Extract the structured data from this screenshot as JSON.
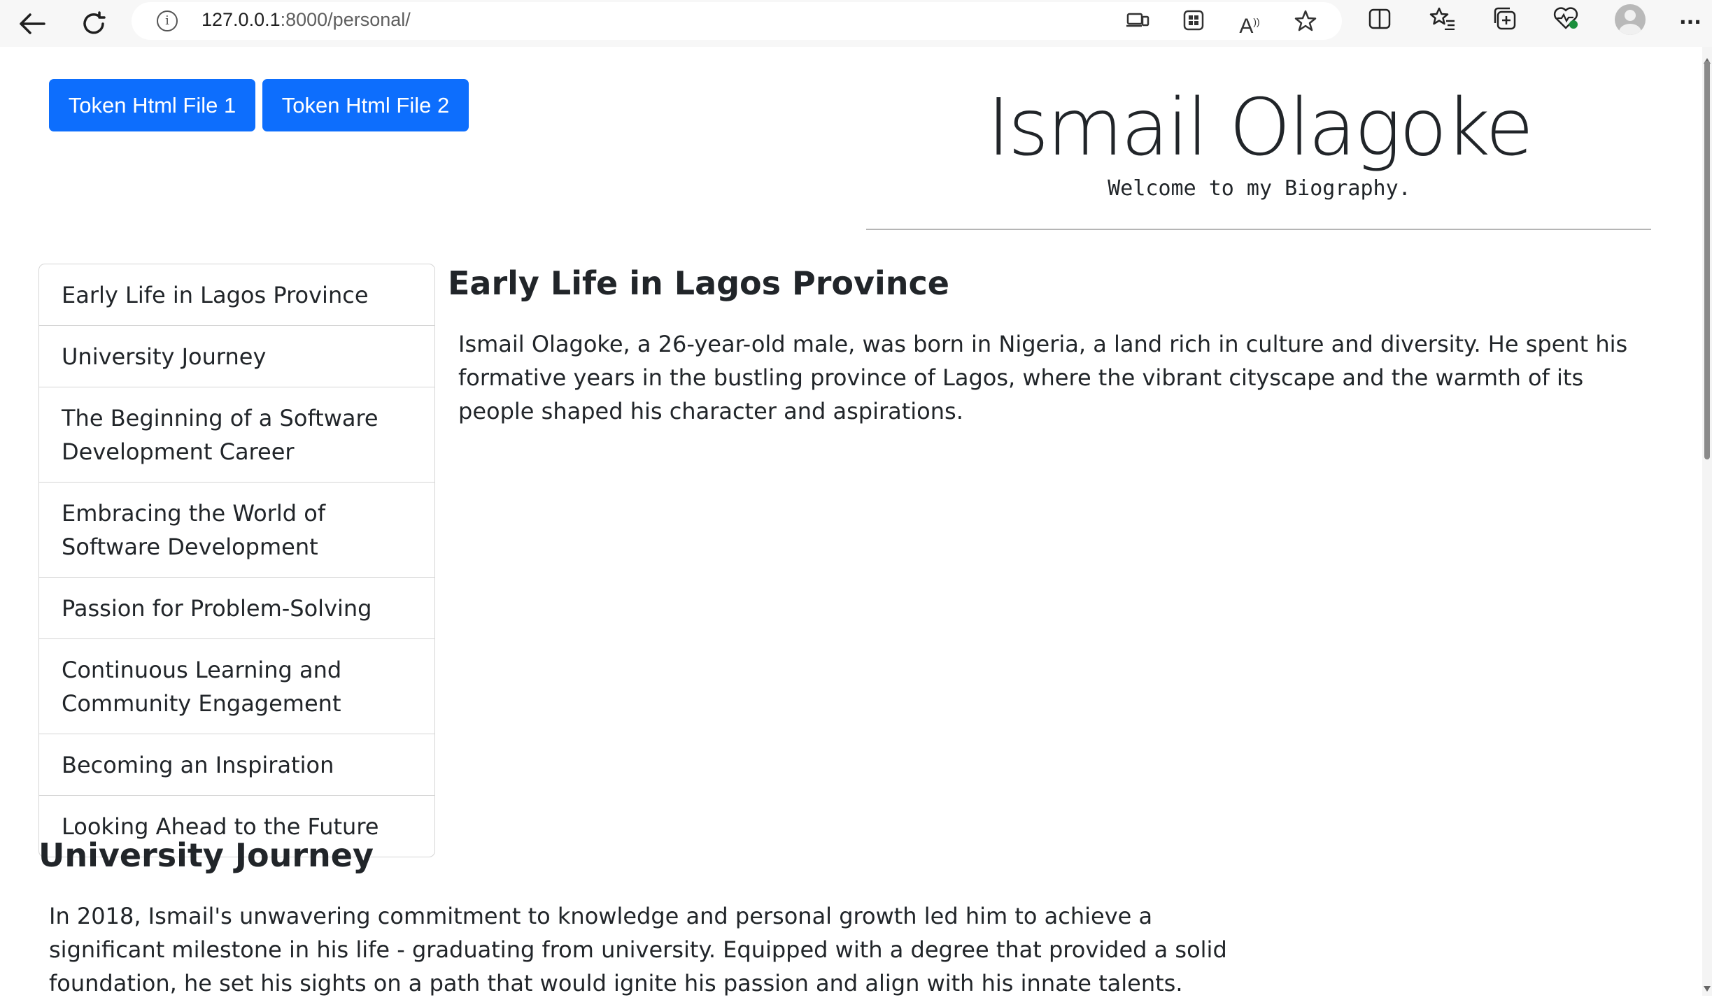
{
  "browser": {
    "url_host": "127.0.0.1",
    "url_rest": ":8000/personal/",
    "icons": {
      "back": "back-arrow-icon",
      "reload": "reload-icon",
      "info": "site-info-icon",
      "device": "device-cast-icon",
      "apps": "apps-grid-icon",
      "read_aloud": "read-aloud-icon",
      "favorite": "star-icon",
      "split": "split-screen-icon",
      "favorites": "favorites-list-icon",
      "collections": "collections-icon",
      "health": "browser-essentials-icon",
      "profile": "profile-avatar-icon",
      "more": "more-menu-icon"
    }
  },
  "page": {
    "buttons": [
      "Token Html File 1",
      "Token Html File 2"
    ],
    "title": "Ismail Olagoke",
    "subtitle": "Welcome to my Biography.",
    "nav": [
      "Early Life in Lagos Province",
      "University Journey",
      "The Beginning of a Software Development Career",
      "Embracing the World of Software Development",
      "Passion for Problem-Solving",
      "Continuous Learning and Community Engagement",
      "Becoming an Inspiration",
      "Looking Ahead to the Future"
    ],
    "sections": [
      {
        "heading": "Early Life in Lagos Province",
        "body": "Ismail Olagoke, a 26-year-old male, was born in Nigeria, a land rich in culture and diversity. He spent his formative years in the bustling province of Lagos, where the vibrant cityscape and the warmth of its people shaped his character and aspirations."
      },
      {
        "heading": "University Journey",
        "body": "In 2018, Ismail's unwavering commitment to knowledge and personal growth led him to achieve a significant milestone in his life - graduating from university. Equipped with a degree that provided a solid foundation, he set his sights on a path that would ignite his passion and align with his innate talents."
      }
    ]
  },
  "colors": {
    "primary": "#0d6efd",
    "text": "#212529",
    "border": "#d5d5d5"
  }
}
